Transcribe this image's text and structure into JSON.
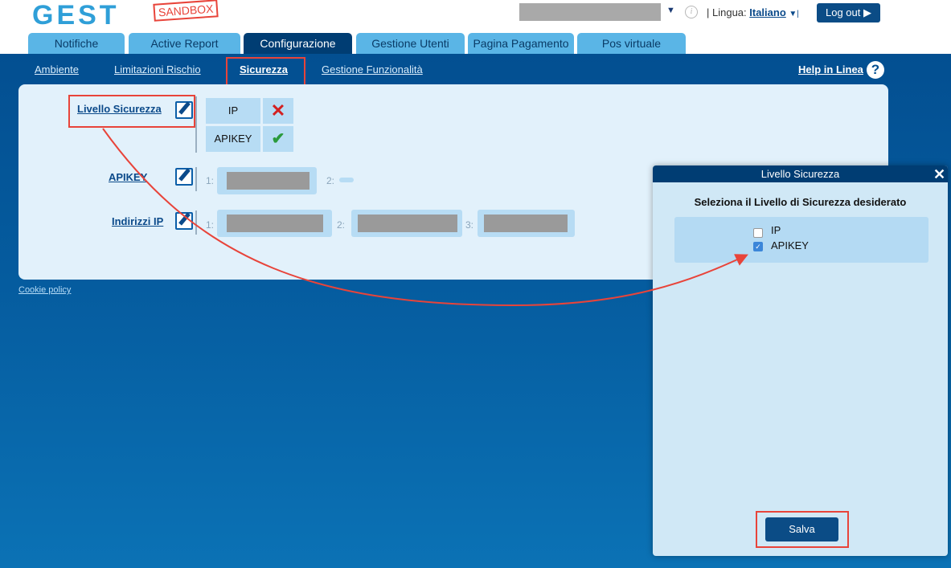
{
  "header": {
    "logo_text": "GEST",
    "sandbox_label": "SANDBOX",
    "info_icon": "i",
    "language_label": "| Lingua:",
    "language_value": "Italiano",
    "language_caret": "▼|",
    "user_caret": "▼",
    "logout_label": "Log out ▶"
  },
  "tabs": [
    {
      "label": "Notifiche"
    },
    {
      "label": "Active Report"
    },
    {
      "label": "Configurazione",
      "active": true
    },
    {
      "label": "Gestione Utenti"
    },
    {
      "label": "Pagina Pagamento"
    },
    {
      "label": "Pos virtuale"
    }
  ],
  "subnav": {
    "items": [
      {
        "label": "Ambiente"
      },
      {
        "label": "Limitazioni Rischio"
      },
      {
        "label": "Sicurezza",
        "active": true
      },
      {
        "label": "Gestione Funzionalità"
      }
    ],
    "help_label": "Help in Linea",
    "help_icon": "?"
  },
  "security": {
    "level_label": "Livello Sicurezza",
    "levels": [
      {
        "name": "IP",
        "enabled": false,
        "mark": "✕"
      },
      {
        "name": "APIKEY",
        "enabled": true,
        "mark": "✔"
      }
    ],
    "apikey_label": "APIKEY",
    "apikey_nums": [
      "1:",
      "2:"
    ],
    "ip_label": "Indirizzi IP",
    "ip_nums": [
      "1:",
      "2:",
      "3:"
    ]
  },
  "cookie_label": "Cookie policy",
  "modal": {
    "title": "Livello Sicurezza",
    "close_icon": "✕",
    "heading": "Seleziona il Livello di Sicurezza desiderato",
    "options": [
      {
        "label": "IP",
        "checked": false
      },
      {
        "label": "APIKEY",
        "checked": true,
        "check_mark": "✓"
      }
    ],
    "save_label": "Salva"
  },
  "colors": {
    "accent": "#003d73",
    "annotation": "#e8443a"
  }
}
